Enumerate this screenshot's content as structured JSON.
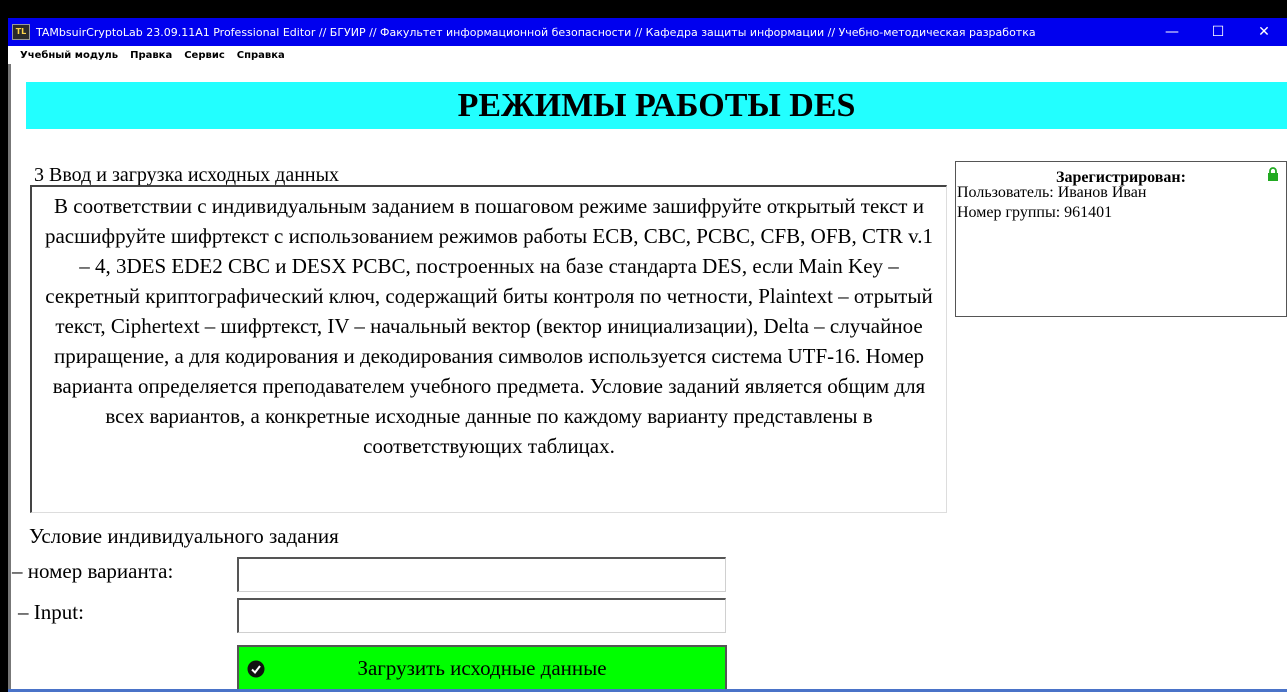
{
  "window": {
    "title": "TAMbsuirCryptoLab 23.09.11A1 Professional Editor // БГУИР // Факультет информационной безопасности // Кафедра защиты информации // Учебно-методическая разработка",
    "controls": {
      "minimize": "—",
      "maximize": "☐",
      "close": "✕"
    }
  },
  "menu": [
    "Учебный модуль",
    "Правка",
    "Сервис",
    "Справка"
  ],
  "heading": "РЕЖИМЫ РАБОТЫ DES",
  "section_title": "3 Ввод и загрузка исходных данных",
  "task_text": "В соответствии с индивидуальным заданием в пошаговом режиме зашифруйте открытый текст и расшифруйте шифртекст с использованием режимов работы ECB, CBC, PCBC, CFB, OFB, CTR v.1 – 4, 3DES EDE2 CBC и DESX PCBC, построенных на базе стандарта DES, если Main Key – секретный криптографический ключ, содержащий биты контроля по четности, Plaintext – отрытый текст, Ciphertext – шифртекст, IV – начальный вектор (вектор инициализации), Delta – случайное приращение, а для кодирования и декодирования символов используется система UTF-16. Номер варианта определяется преподавателем учебного предмета. Условие заданий является общим для всех вариантов, а конкретные исходные данные по каждому варианту представлены в соответствующих таблицах.",
  "registration": {
    "title": "Зарегистрирован:",
    "user": "Пользователь: Иванов Иван",
    "group": "Номер группы: 961401",
    "lock_color": "#22aa22"
  },
  "condition": {
    "title": "Условие индивидуального задания",
    "variant_label": "– номер варианта:",
    "variant_value": "",
    "input_label": "– Input:",
    "input_value": ""
  },
  "load_button": {
    "label": "Загрузить исходные данные",
    "color": "#00ff00"
  },
  "colors": {
    "titlebar": "#0000ee",
    "heading_bg": "#22ffff"
  }
}
